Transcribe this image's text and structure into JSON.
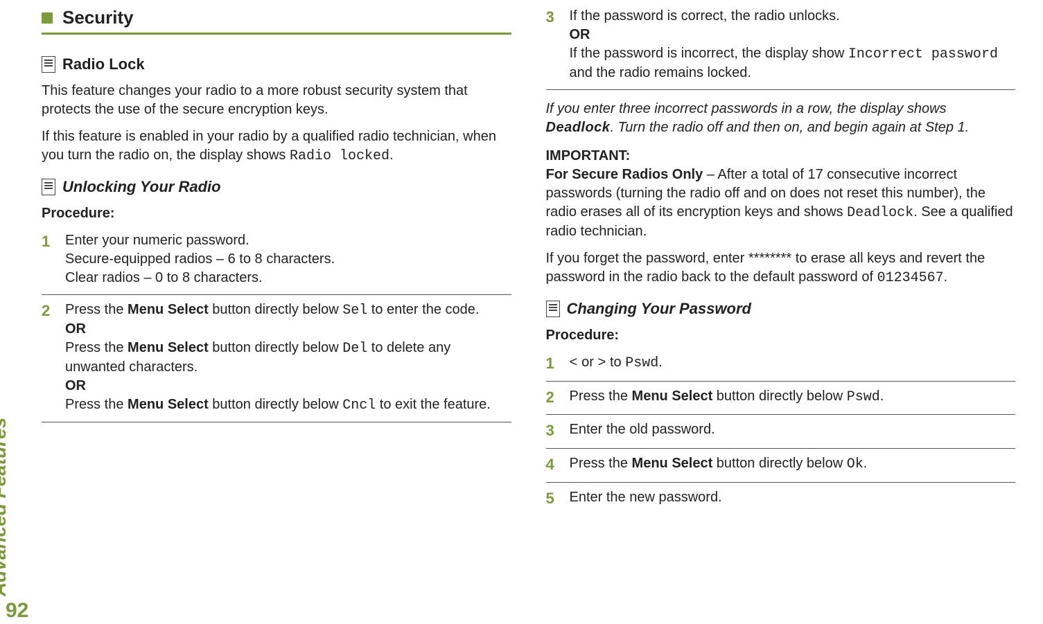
{
  "side_label": "Advanced Features",
  "page_number": "92",
  "left": {
    "heading": "Security",
    "sub1": {
      "title": "Radio Lock"
    },
    "p1": "This feature changes your radio to a more robust security system that protects the use of the secure encryption keys.",
    "p2_a": "If this feature is enabled in your radio by a qualified radio technician, when you turn the radio on, the display shows ",
    "p2_code": "Radio locked",
    "p2_b": ".",
    "sub2": {
      "title": "Unlocking Your Radio"
    },
    "procedure_label": "Procedure:",
    "steps": [
      {
        "num": "1",
        "lines": [
          {
            "text": "Enter your numeric password."
          },
          {
            "text": "Secure-equipped radios – 6 to 8 characters."
          },
          {
            "text": "Clear radios – 0 to 8 characters."
          }
        ]
      },
      {
        "num": "2",
        "lines": [
          {
            "pre": "Press the ",
            "bold": "Menu Select",
            "mid": " button directly below ",
            "code": "Sel",
            "post": " to enter the code."
          },
          {
            "or": "OR"
          },
          {
            "pre": "Press the ",
            "bold": "Menu Select",
            "mid": " button directly below ",
            "code": "Del",
            "post": " to delete any unwanted characters."
          },
          {
            "or": "OR"
          },
          {
            "pre": "Press the ",
            "bold": "Menu Select",
            "mid": " button directly below ",
            "code": "Cncl",
            "post": " to exit the feature."
          }
        ]
      }
    ]
  },
  "right": {
    "step3": {
      "num": "3",
      "line1": "If the password is correct, the radio unlocks.",
      "or": "OR",
      "line2_a": "If the password is incorrect, the display show ",
      "line2_code": "Incorrect password",
      "line2_b": " and the radio remains locked."
    },
    "note1_a": "If you enter three incorrect passwords in a row, the display shows ",
    "note1_dead": "Deadlock",
    "note1_b": ". Turn the radio off and then on, and begin again at Step 1.",
    "important_label": "IMPORTANT:",
    "important_bold": "For Secure Radios Only",
    "important_dash": " – ",
    "important_body_a": "After a total of 17 consecutive incorrect passwords (turning the radio off and on does not reset this number), the radio erases all of its encryption keys and shows ",
    "important_code": "Deadlock",
    "important_body_b": ". See a qualified radio technician.",
    "forgot_a": "If you forget the password, enter ",
    "forgot_stars": "********",
    "forgot_b": " to erase all keys and revert the password in the radio back to the default password of ",
    "forgot_code": "01234567",
    "forgot_c": ".",
    "sub3": {
      "title": "Changing Your Password"
    },
    "procedure_label": "Procedure:",
    "steps": [
      {
        "num": "1",
        "code_a": "<",
        "mid": " or ",
        "code_b": ">",
        "post": " to ",
        "code_c": "Pswd",
        "tail": "."
      },
      {
        "num": "2",
        "pre": "Press the ",
        "bold": "Menu Select",
        "mid": " button directly below ",
        "code": "Pswd",
        "post": "."
      },
      {
        "num": "3",
        "plain": "Enter the old password."
      },
      {
        "num": "4",
        "pre": "Press the ",
        "bold": "Menu Select",
        "mid": " button directly below ",
        "code": "Ok",
        "post": "."
      },
      {
        "num": "5",
        "plain": "Enter the new password."
      }
    ]
  }
}
